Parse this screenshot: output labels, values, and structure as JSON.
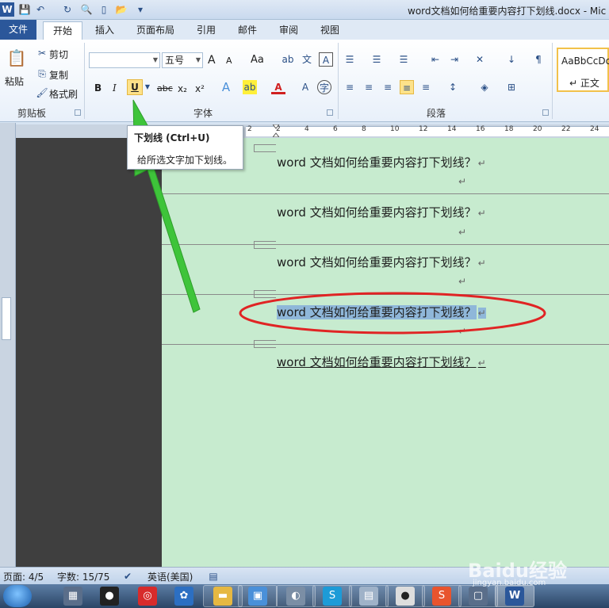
{
  "window": {
    "title": "word文档如何给重要内容打下划线.docx - Mic"
  },
  "ribbon": {
    "file_tab": "文件",
    "tabs": [
      "开始",
      "插入",
      "页面布局",
      "引用",
      "邮件",
      "审阅",
      "视图"
    ],
    "active_tab": "开始",
    "clipboard": {
      "paste": "粘贴",
      "cut": "剪切",
      "copy": "复制",
      "format_painter": "格式刷",
      "group_label": "剪贴板"
    },
    "font": {
      "font_name": "",
      "font_size": "五号",
      "grow": "A",
      "shrink": "A",
      "change_case": "Aa",
      "bold": "B",
      "italic": "I",
      "underline": "U",
      "strikethrough": "abc",
      "subscript": "x₂",
      "superscript": "x²",
      "group_label": "字体"
    },
    "paragraph": {
      "group_label": "段落"
    },
    "styles": {
      "preview": "AaBbCcDd",
      "normal": "↵ 正文"
    }
  },
  "tooltip": {
    "title": "下划线 (Ctrl+U)",
    "description": "给所选文字加下划线。"
  },
  "ruler": {
    "ticks": [
      "2",
      "2",
      "4",
      "6",
      "8",
      "10",
      "12",
      "14",
      "16",
      "18",
      "20",
      "22",
      "24"
    ]
  },
  "document": {
    "lines": [
      {
        "text": "word 文档如何给重要内容打下划线？",
        "mark": "↵",
        "style": "normal"
      },
      {
        "text": "word 文档如何给重要内容打下划线？",
        "mark": "↵",
        "style": "normal"
      },
      {
        "text": "word 文档如何给重要内容打下划线？",
        "mark": "↵",
        "style": "normal"
      },
      {
        "text": "word 文档如何给重要内容打下划线？",
        "mark": "↵",
        "style": "selected"
      },
      {
        "text": "word 文档如何给重要内容打下划线？",
        "mark": "↵",
        "style": "underlined"
      }
    ],
    "empty_mark": "↵"
  },
  "statusbar": {
    "page": "页面: 4/5",
    "words": "字数: 15/75",
    "language": "英语(美国)"
  },
  "annotations": {
    "ellipse_color": "#e02424",
    "arrow_color": "#3ec43a"
  },
  "watermark": {
    "logo": "Baidu经验",
    "url": "jingyan.baidu.com"
  },
  "colors": {
    "page_bg": "#c7ebcf",
    "selection": "#8fb7d9",
    "file_tab": "#2b579a",
    "highlight_button": "#fde28a"
  }
}
